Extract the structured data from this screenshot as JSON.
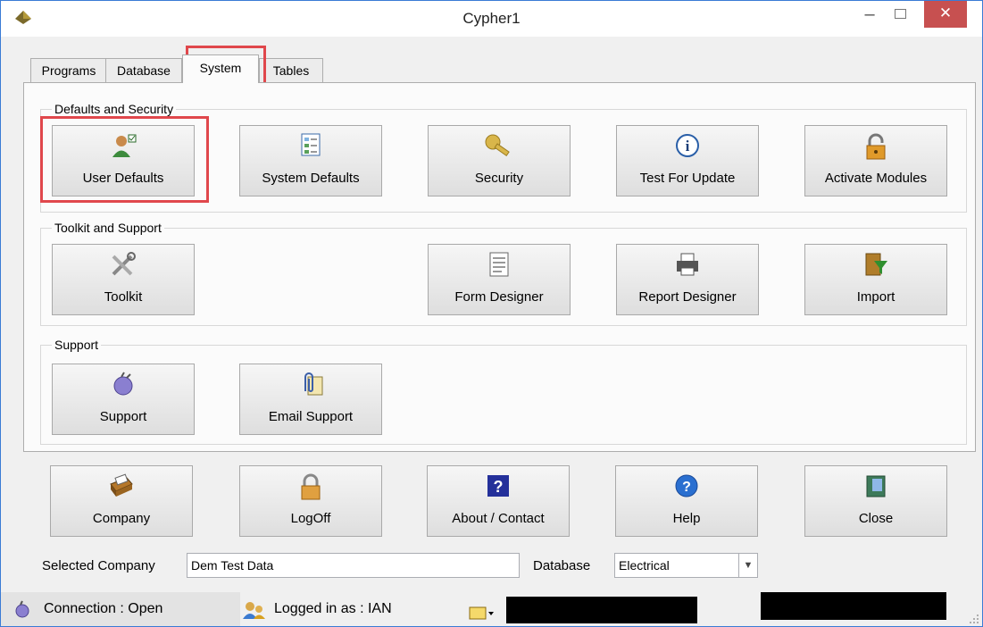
{
  "window": {
    "title": "Cypher1",
    "minimize_glyph": "–",
    "close_glyph": "✕"
  },
  "tabs": [
    {
      "label": "Programs",
      "active": false
    },
    {
      "label": "Database",
      "active": false
    },
    {
      "label": "System",
      "active": true
    },
    {
      "label": "Tables",
      "active": false
    }
  ],
  "groups": {
    "defaults_security": {
      "label": "Defaults and Security",
      "buttons": [
        {
          "label": "User Defaults",
          "icon": "user-check-icon"
        },
        {
          "label": "System Defaults",
          "icon": "checklist-icon"
        },
        {
          "label": "Security",
          "icon": "key-icon"
        },
        {
          "label": "Test For Update",
          "icon": "info-icon"
        },
        {
          "label": "Activate Modules",
          "icon": "padlock-icon"
        }
      ]
    },
    "toolkit_support": {
      "label": "Toolkit and Support",
      "buttons": [
        {
          "label": "Toolkit",
          "icon": "tools-icon"
        },
        {
          "label": "Form Designer",
          "icon": "form-icon"
        },
        {
          "label": "Report Designer",
          "icon": "printer-icon"
        },
        {
          "label": "Import",
          "icon": "import-funnel-icon"
        }
      ]
    },
    "support": {
      "label": "Support",
      "buttons": [
        {
          "label": "Support",
          "icon": "plug-icon"
        },
        {
          "label": "Email Support",
          "icon": "paperclip-icon"
        }
      ]
    }
  },
  "bottom_buttons": [
    {
      "label": "Company",
      "icon": "card-file-icon"
    },
    {
      "label": "LogOff",
      "icon": "lock-icon"
    },
    {
      "label": "About / Contact",
      "icon": "question-icon"
    },
    {
      "label": "Help",
      "icon": "help-circle-icon"
    },
    {
      "label": "Close",
      "icon": "exit-door-icon"
    }
  ],
  "selected_company": {
    "label": "Selected Company",
    "value": "Dem Test Data"
  },
  "database": {
    "label": "Database",
    "value": "Electrical"
  },
  "status": {
    "connection": "Connection : Open",
    "logged_in": "Logged in as : IAN"
  },
  "colors": {
    "highlight": "#e0474c",
    "close_button": "#c75050",
    "border": "#3a7bd5"
  }
}
